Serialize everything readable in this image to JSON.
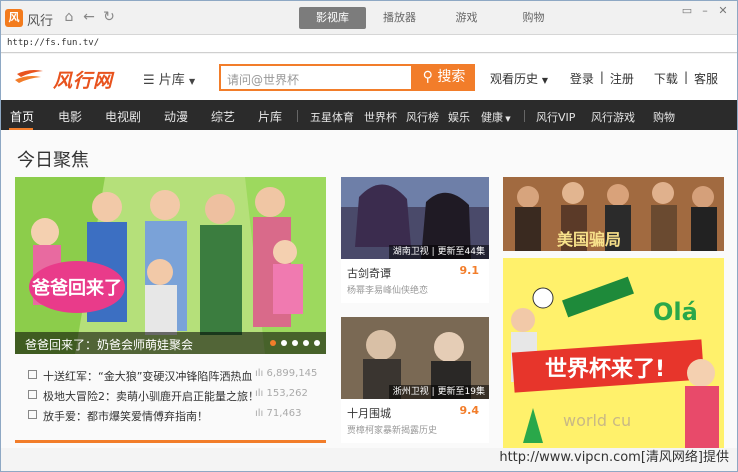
{
  "app": {
    "name": "风行"
  },
  "tabs": [
    {
      "label": "影视库",
      "active": true
    },
    {
      "label": "播放器",
      "active": false
    },
    {
      "label": "游戏",
      "active": false
    },
    {
      "label": "购物",
      "active": false
    }
  ],
  "address": "http://fs.fun.tv/",
  "header": {
    "logo_text": "风行网",
    "category_dropdown": "片库",
    "search_placeholder": "请问@世界杯",
    "search_button": "搜索",
    "history": "观看历史",
    "links": [
      "登录",
      "|",
      "注册",
      "下载",
      "|",
      "客服"
    ]
  },
  "nav": {
    "items": [
      {
        "label": "首页",
        "active": true
      },
      {
        "label": "电影"
      },
      {
        "label": "电视剧"
      },
      {
        "label": "动漫"
      },
      {
        "label": "综艺"
      },
      {
        "label": "片库"
      },
      {
        "label": "五星体育"
      },
      {
        "label": "世界杯"
      },
      {
        "label": "风行榜"
      },
      {
        "label": "娱乐"
      },
      {
        "label": "健康"
      },
      {
        "label": "风行VIP"
      },
      {
        "label": "风行游戏"
      },
      {
        "label": "购物"
      }
    ]
  },
  "section_title": "今日聚焦",
  "banner": {
    "caption": "爸爸回来了：奶爸会师萌娃聚会",
    "art_text": "爸爸回来了",
    "slides": 5,
    "active_slide": 1
  },
  "news": [
    {
      "title": "十送红军：“金大狼”变硬汉冲锋陷阵洒热血",
      "count": "6,899,145"
    },
    {
      "title": "极地大冒险2：卖萌小驯鹿开启正能量之旅！",
      "count": "153,262"
    },
    {
      "title": "放手爱：都市爆笑爱情傅弃指南！",
      "count": "71,463"
    }
  ],
  "cards": [
    {
      "title": "古剑奇谭",
      "score": "9.1",
      "desc": "杨幂李易峰仙侠绝恋",
      "tag": "湖南卫视 | 更新至44集"
    },
    {
      "title": "十月围城",
      "score": "9.4",
      "desc": "贾樟柯家暴新揭露历史",
      "tag": "浙州卫视 | 更新至19集"
    }
  ],
  "right_a": {
    "text": "美国骗局"
  },
  "right_b": {
    "text": "世界杯来了!",
    "ola": "Olá",
    "wc": "world cu"
  },
  "watermark": "http://www.vipcn.com[清风网络]提供",
  "colors": {
    "accent": "#f27d2a",
    "navbar": "#2b2b2b"
  }
}
